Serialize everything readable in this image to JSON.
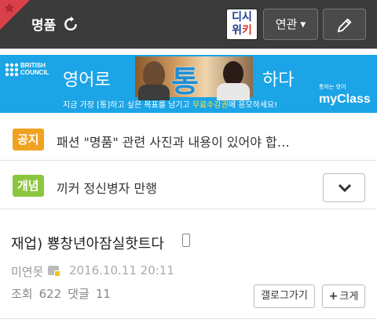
{
  "header": {
    "gallery_name": "명품",
    "dcwiki_line1": "디시",
    "dcwiki_line2_a": "위",
    "dcwiki_line2_b": "키",
    "related_label": "연관",
    "related_caret": "▼",
    "icons": [
      "star-icon",
      "refresh-icon",
      "pencil-icon"
    ],
    "colors": {
      "bar": "#3b3b3b",
      "corner": "#d9404a"
    }
  },
  "banner": {
    "logo_line1": "BRITISH",
    "logo_line2": "COUNCIL",
    "left_text": "영어로",
    "center_text": "통",
    "right_text": "하다",
    "sub_text_1": "지금 가장 [통]하고 싶은 목표를 남기고 ",
    "sub_text_highlight": "무료수강권",
    "sub_text_2": "에 응모하세요!",
    "brand_small": "통하는 영어",
    "brand": "myClass",
    "colors": {
      "background": "#1ba4e6",
      "highlight": "#ffeb3b"
    }
  },
  "notices": [
    {
      "badge": "공지",
      "text": "패션 \"명품\" 관련 사진과 내용이 있어야 합…",
      "badge_color": "#f0a221"
    },
    {
      "badge": "개념",
      "text": "끼커 정신병자 만행",
      "badge_color": "#8cc63f"
    }
  ],
  "post": {
    "title": "재업) 뿅창년아잠실핫트다",
    "author": "미연못",
    "date": "2016.10.11 20:11",
    "views_label": "조회",
    "views": "622",
    "comments_label": "댓글",
    "comments": "11",
    "gallery_button": "갤로그가기",
    "big_button_plus": "+",
    "big_button": "크게"
  }
}
